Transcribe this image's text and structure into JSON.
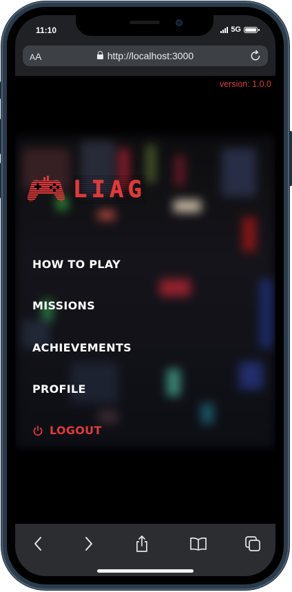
{
  "status_bar": {
    "time": "11:10",
    "network": "5G"
  },
  "browser": {
    "text_size_label": {
      "small": "A",
      "big": "A"
    },
    "url": "http://localhost:3000"
  },
  "app": {
    "version": "version: 1.0.0",
    "logo_text": "LIAG",
    "menu": [
      {
        "label": "HOW TO PLAY"
      },
      {
        "label": "MISSIONS"
      },
      {
        "label": "ACHIEVEMENTS"
      },
      {
        "label": "PROFILE"
      }
    ],
    "logout_label": "LOGOUT"
  },
  "colors": {
    "accent": "#e03a3a",
    "background": "#000000",
    "menu_text": "#ffffff",
    "browser_chrome": "#2b2d30"
  },
  "icons": {
    "logo": "gamepad-icon",
    "logout": "power-icon",
    "toolbar": [
      "back-arrow-icon",
      "forward-arrow-icon",
      "share-icon",
      "bookmarks-icon",
      "tabs-icon"
    ]
  }
}
